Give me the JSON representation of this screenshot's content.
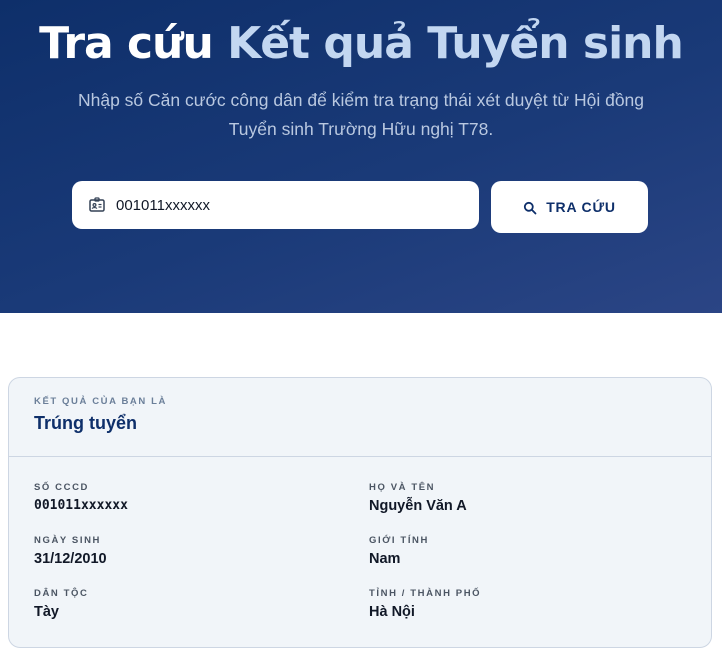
{
  "hero": {
    "title_main": "Tra cứu",
    "title_accent": "Kết quả Tuyển sinh",
    "subtitle": "Nhập số Căn cước công dân để kiểm tra trạng thái xét duyệt từ Hội đồng Tuyển sinh Trường Hữu nghị T78.",
    "search_value": "001011xxxxxx",
    "search_icon": "id-card-icon",
    "button_label": "TRA CỨU",
    "button_icon": "search-icon",
    "colors": {
      "background": "#0e2f6a",
      "accent": "#c3d7f1"
    }
  },
  "result": {
    "eyebrow": "KẾT QUẢ CỦA BẠN LÀ",
    "status": "Trúng tuyển",
    "fields": {
      "cccd": {
        "label": "SỐ CCCD",
        "value": "001011xxxxxx"
      },
      "full_name": {
        "label": "HỌ VÀ TÊN",
        "value": "Nguyễn Văn A"
      },
      "dob": {
        "label": "NGÀY SINH",
        "value": "31/12/2010"
      },
      "gender": {
        "label": "GIỚI TÍNH",
        "value": "Nam"
      },
      "ethnicity": {
        "label": "DÂN TỘC",
        "value": "Tày"
      },
      "province": {
        "label": "TỈNH / THÀNH PHỐ",
        "value": "Hà Nội"
      }
    }
  }
}
